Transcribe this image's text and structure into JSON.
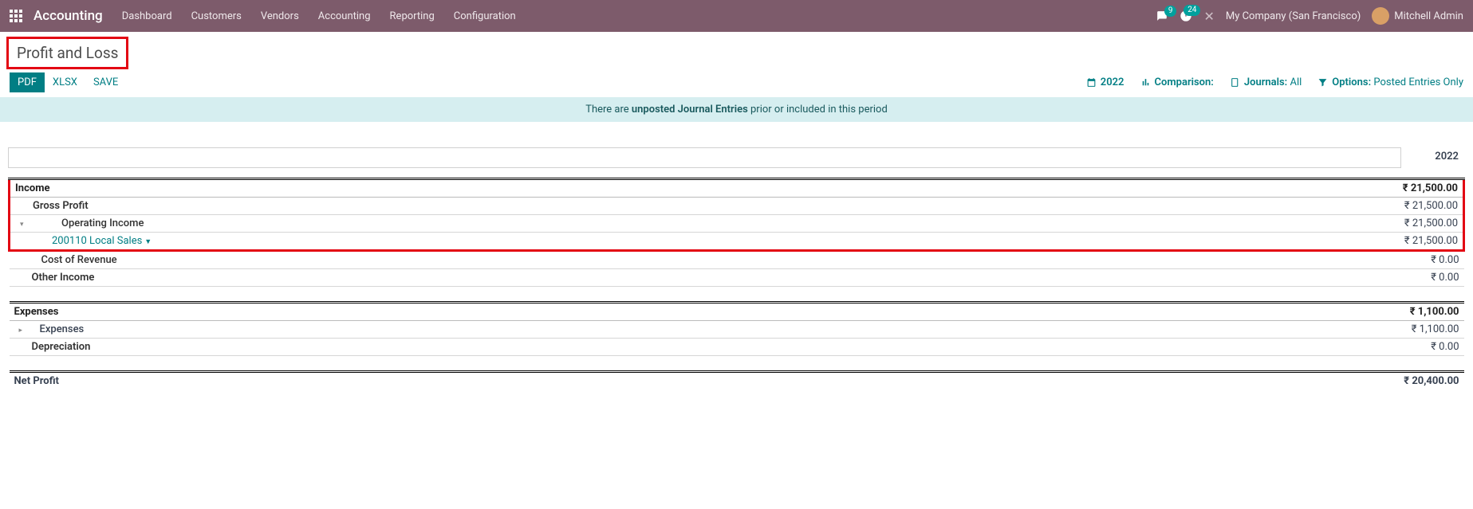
{
  "nav": {
    "app_title": "Accounting",
    "menu": [
      "Dashboard",
      "Customers",
      "Vendors",
      "Accounting",
      "Reporting",
      "Configuration"
    ],
    "msg_badge": "9",
    "activity_badge": "24",
    "company": "My Company (San Francisco)",
    "user": "Mitchell Admin"
  },
  "page_title": "Profit and Loss",
  "actions": {
    "pdf": "PDF",
    "xlsx": "XLSX",
    "save": "SAVE"
  },
  "filters": {
    "date_label": "2022",
    "comparison_label": "Comparison:",
    "journals_prefix": "Journals:",
    "journals_value": "All",
    "options_prefix": "Options:",
    "options_value": "Posted Entries Only"
  },
  "alert_prefix": "There are ",
  "alert_link": "unposted Journal Entries",
  "alert_suffix": " prior or included in this period",
  "col_year": "2022",
  "rows": {
    "income_label": "Income",
    "income_amt": "₹ 21,500.00",
    "gross_profit_label": "Gross Profit",
    "gross_profit_amt": "₹ 21,500.00",
    "op_income_label": "Operating Income",
    "op_income_amt": "₹ 21,500.00",
    "local_sales_label": "200110 Local Sales",
    "local_sales_amt": "₹ 21,500.00",
    "cost_rev_label": "Cost of Revenue",
    "cost_rev_amt": "₹ 0.00",
    "other_income_label": "Other Income",
    "other_income_amt": "₹ 0.00",
    "expenses_label": "Expenses",
    "expenses_amt": "₹ 1,100.00",
    "expenses2_label": "Expenses",
    "expenses2_amt": "₹ 1,100.00",
    "depr_label": "Depreciation",
    "depr_amt": "₹ 0.00",
    "net_label": "Net Profit",
    "net_amt": "₹ 20,400.00"
  }
}
